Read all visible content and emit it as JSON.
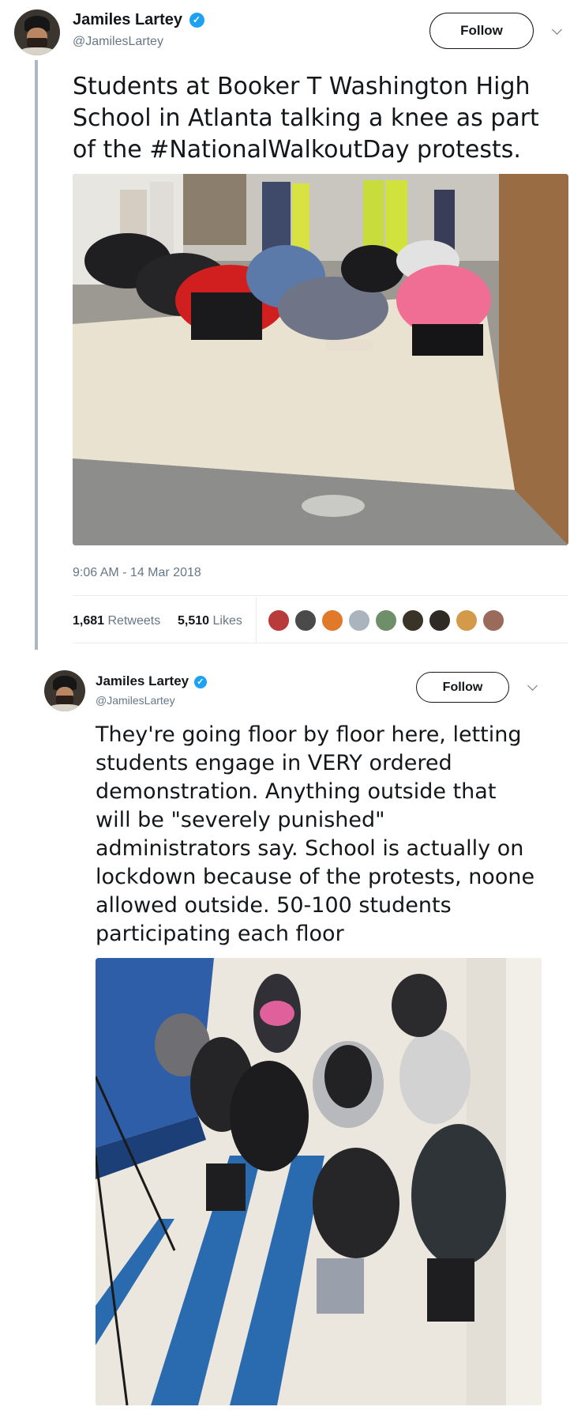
{
  "tweets": [
    {
      "author": {
        "name": "Jamiles Lartey",
        "handle": "@JamilesLartey"
      },
      "follow_label": "Follow",
      "text": "Students at Booker T Washington High\nSchool in Atlanta talking a knee as part\nof the #NationalWalkoutDay protests.",
      "timestamp": "9:06 AM - 14 Mar 2018",
      "retweets": {
        "count": "1,681",
        "label": "Retweets"
      },
      "likes": {
        "count": "5,510",
        "label": "Likes"
      },
      "liker_colors": [
        "#b83a3a",
        "#4a4a4a",
        "#e07a2a",
        "#aab4bd",
        "#6f8f6a",
        "#3a3328",
        "#2f2a24",
        "#d39a4a",
        "#9a6a5a"
      ]
    },
    {
      "author": {
        "name": "Jamiles Lartey",
        "handle": "@JamilesLartey"
      },
      "follow_label": "Follow",
      "text": "They're going floor by floor here, letting\nstudents engage in VERY ordered\ndemonstration. Anything outside that\nwill be \"severely punished\"\nadministrators say.  School is actually on\nlockdown because of the protests, noone\nallowed outside. 50-100 students\nparticipating each floor"
    }
  ],
  "colors": {
    "verified": "#1da1f2",
    "secondary_text": "#657786",
    "thread_line": "#aab8c2"
  },
  "icons": [
    "verified-badge-icon",
    "chevron-down-icon"
  ]
}
